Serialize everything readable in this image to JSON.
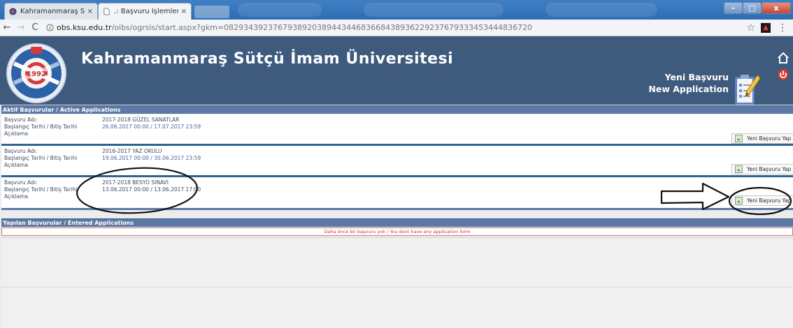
{
  "browser": {
    "tabs": [
      {
        "title": "Kahramanmaraş Sütçü İ",
        "close": "×"
      },
      {
        "title": ".: Başvuru İşlemleri :.",
        "close": "×"
      }
    ],
    "url_host": "obs.ksu.edu.tr",
    "url_path": "/oibs/ogrsis/start.aspx?gkm=08293439237679389203894434468366843893622923767933345344483672​0",
    "window_controls": {
      "minimize": "–",
      "maximize": "□",
      "close": "x"
    },
    "back": "←",
    "forward": "→",
    "reload": "C",
    "star": "☆",
    "menu": "⋮"
  },
  "header": {
    "title": "Kahramanmaraş Sütçü İmam Üniversitesi",
    "new_application_tr": "Yeni Başvuru",
    "new_application_en": "New Application",
    "logo_year": "1992"
  },
  "active_section": {
    "title": "Aktif Başvurular / Active Applications"
  },
  "labels": {
    "name": "Başvuru Adı:",
    "dates": "Başlangıç Tarihi / Bitiş Tarihi",
    "description": "Açıklama"
  },
  "applications": [
    {
      "name": "2017-2018 GÜZEL SANATLAR",
      "dates": "26.06.2017 00:00  /  17.07.2017 23:59",
      "button": "Yeni Başvuru Yap"
    },
    {
      "name": "2016-2017 YAZ OKULU",
      "dates": "19.06.2017 00:00  /  30.06.2017 23:59",
      "button": "Yeni Başvuru Yap"
    },
    {
      "name": "2017-2018 BESYO SINAVI",
      "dates": "13.06.2017 00:00  /  13.06.2017 17:00",
      "button": "Yeni Başvuru Yap"
    }
  ],
  "entered_section": {
    "title": "Yapılan Başvurular / Entered Applications",
    "empty_message": "Daha önce bir başvuru yok / You dont have any application form"
  }
}
